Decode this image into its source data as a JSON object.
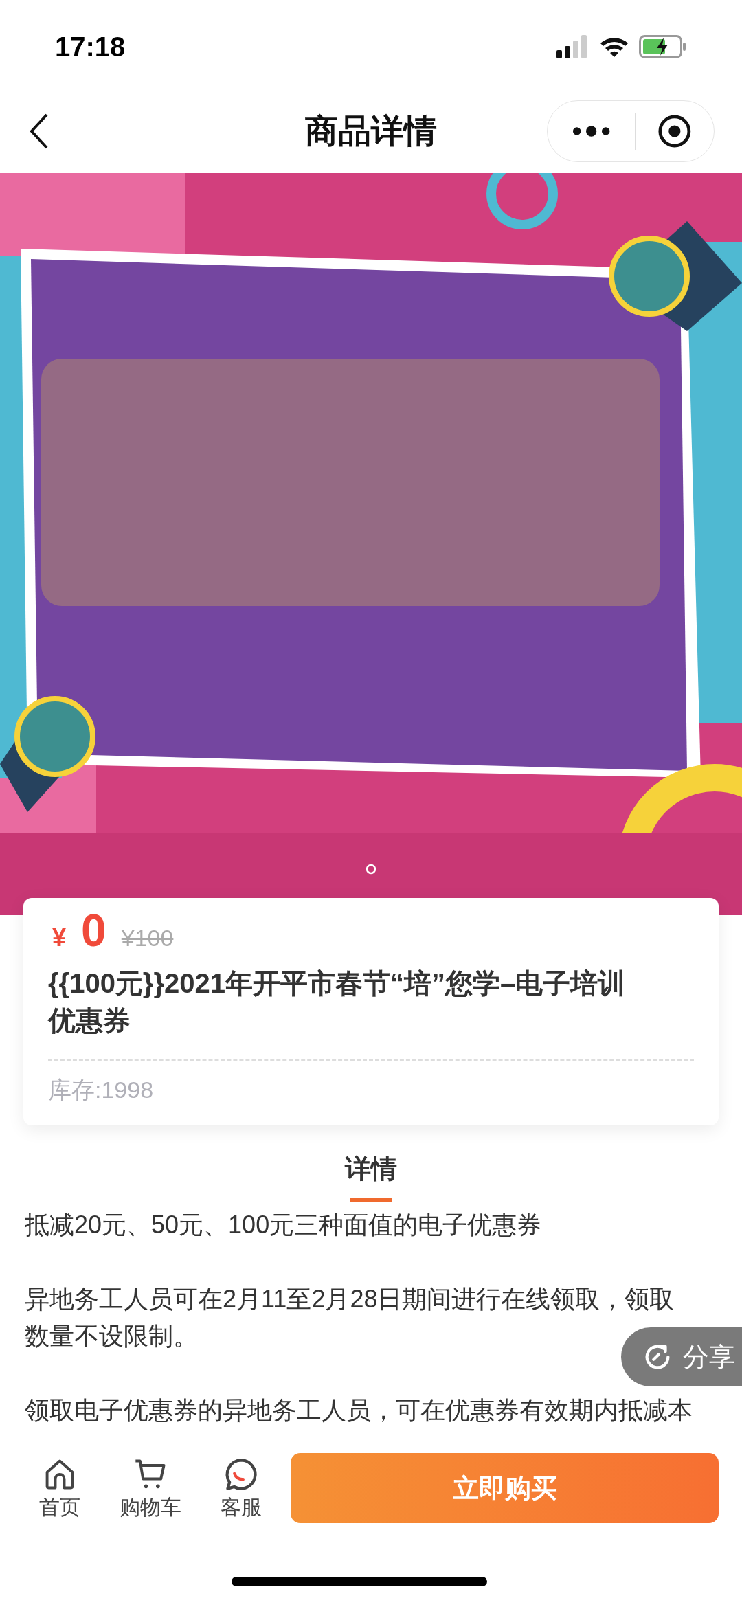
{
  "status_bar": {
    "time": "17:18"
  },
  "nav": {
    "title": "商品详情"
  },
  "product": {
    "currency": "¥",
    "price": "0",
    "original_price": "¥100",
    "title": "{{100元}}2021年开平市春节“培”您学–电子培训优惠券",
    "stock": "库存:1998"
  },
  "detail_tabs": [
    {
      "label": "详情",
      "selected": true
    }
  ],
  "description": [
    "抵减20元、50元、100元三种面值的电子优惠券",
    "异地务工人员可在2月11至2月28日期间进行在线领取，领取数量不设限制。",
    "领取电子优惠券的异地务工人员，可在优惠券有效期内抵减本"
  ],
  "share_button": {
    "label": "分享"
  },
  "bottom_bar": {
    "items": [
      {
        "kind": "home",
        "label": "首页"
      },
      {
        "kind": "cart",
        "label": "购物车"
      },
      {
        "kind": "service",
        "label": "客服"
      }
    ],
    "buy_button": "立即购买"
  }
}
